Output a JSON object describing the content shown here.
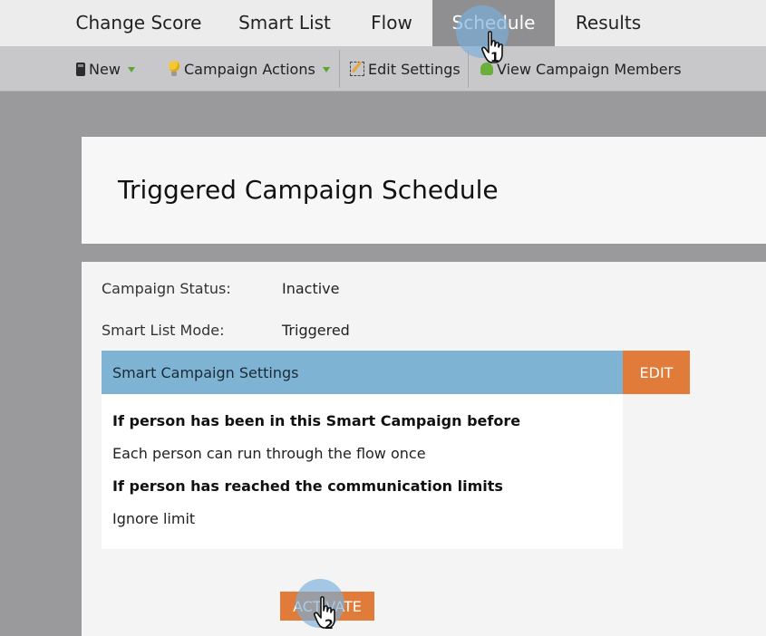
{
  "tabs": [
    {
      "label": "Change Score",
      "active": false
    },
    {
      "label": "Smart List",
      "active": false
    },
    {
      "label": "Flow",
      "active": false
    },
    {
      "label": "Schedule",
      "active": true
    },
    {
      "label": "Results",
      "active": false
    }
  ],
  "toolbar": {
    "new_label": "New",
    "campaign_actions_label": "Campaign Actions",
    "edit_settings_label": "Edit Settings",
    "view_members_label": "View Campaign Members"
  },
  "page": {
    "title": "Triggered Campaign Schedule"
  },
  "fields": {
    "campaign_status_label": "Campaign Status:",
    "campaign_status_value": "Inactive",
    "smart_list_mode_label": "Smart List Mode:",
    "smart_list_mode_value": "Triggered"
  },
  "settings": {
    "header": "Smart Campaign Settings",
    "edit_label": "EDIT",
    "lines": [
      {
        "text": "If person has been in this Smart Campaign before",
        "bold": true
      },
      {
        "text": "Each person can run through the flow once",
        "bold": false
      },
      {
        "text": "If person has reached the communication limits",
        "bold": true
      },
      {
        "text": "Ignore limit",
        "bold": false
      }
    ]
  },
  "activate_label": "ACTIVATE",
  "annotations": {
    "step1": "1",
    "step2": "2"
  },
  "colors": {
    "accent_orange": "#e07b39",
    "header_blue": "#7fb3d3",
    "tab_active": "#8f8f91"
  }
}
